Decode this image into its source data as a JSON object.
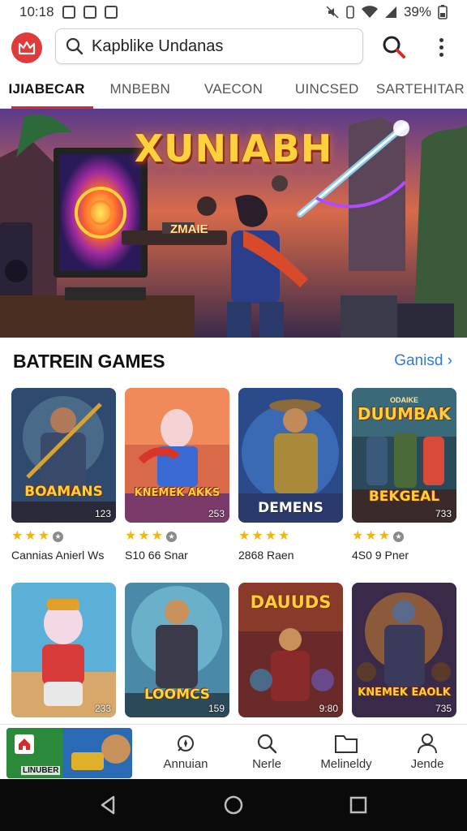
{
  "status_bar": {
    "time": "10:18",
    "battery": "39%"
  },
  "header": {
    "search_value": "Kapblike Undanas"
  },
  "tabs": [
    {
      "label": "IJIABECAR"
    },
    {
      "label": "MNBEBN"
    },
    {
      "label": "VAECON"
    },
    {
      "label": "UINCSED"
    },
    {
      "label": "SARTEHITAR"
    }
  ],
  "hero": {
    "subtitle": "ZMAIE",
    "title": "XUNIABH"
  },
  "section": {
    "title": "BATREIN GAMES",
    "link": "Ganisd"
  },
  "games": [
    {
      "logo": "BOAMANS",
      "count": "123",
      "meta": "Cannias Anierl Ws",
      "stars": 3
    },
    {
      "logo": "KNEMEK AKKS",
      "count": "253",
      "meta": "S10 66 Snar",
      "stars": 3
    },
    {
      "logo": "DEMENS",
      "count": "",
      "meta": "2868 Raen",
      "stars": 4
    },
    {
      "logo": "DUUMBAK",
      "logo_top": "ODAIKE",
      "logo_bottom": "BEKGEAL",
      "count": "733",
      "meta": "4S0 9 Pner",
      "stars": 3
    },
    {
      "logo": "",
      "count": "233",
      "meta": "",
      "stars": 0
    },
    {
      "logo": "LOOMCS",
      "count": "159",
      "meta": "",
      "stars": 0
    },
    {
      "logo": "DAUUDS",
      "count": "9:80",
      "meta": "",
      "stars": 0
    },
    {
      "logo": "KNEMEK EAOLK",
      "count": "735",
      "meta": "",
      "stars": 0
    }
  ],
  "bottom_nav": {
    "promo_label": "LINUBER",
    "items": [
      {
        "label": "Annuian",
        "icon": "compass-icon"
      },
      {
        "label": "Nerle",
        "icon": "search-icon"
      },
      {
        "label": "Melineldy",
        "icon": "folder-icon"
      },
      {
        "label": "Jende",
        "icon": "profile-icon"
      }
    ]
  },
  "colors": {
    "accent": "#d52b2b",
    "link": "#2f7bd6",
    "star": "#f2b40f"
  }
}
